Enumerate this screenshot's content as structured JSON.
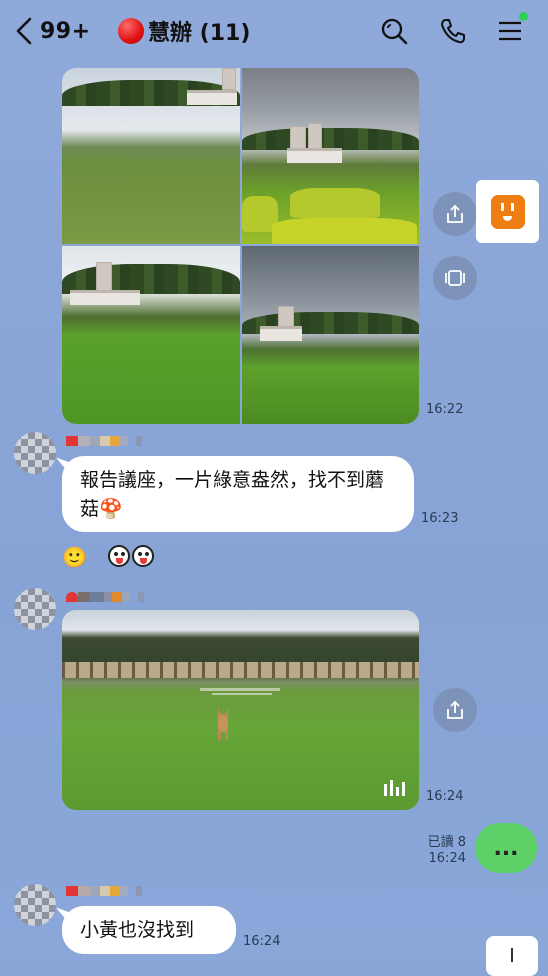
{
  "header": {
    "back_count": "99+",
    "title": "慧辦 (11)",
    "icons": [
      "back-chevron-icon",
      "search-icon",
      "phone-icon",
      "menu-icon"
    ]
  },
  "messages": {
    "photos_time": "16:22",
    "text1": "報告議座，一片綠意盎然，找不到蘑菇🍄",
    "text1_time": "16:23",
    "reaction_emojis": "🙂",
    "video_time": "16:24",
    "read_label": "已讀 8",
    "own_time": "16:24",
    "own_text": "...",
    "text2": "小黃也沒找到",
    "text2_time": "16:24"
  },
  "colors": {
    "background": "#8aa6d8",
    "own_bubble": "#5dd168",
    "unread_dot": "#2ed158",
    "outlet_badge": "#ee7d12"
  }
}
